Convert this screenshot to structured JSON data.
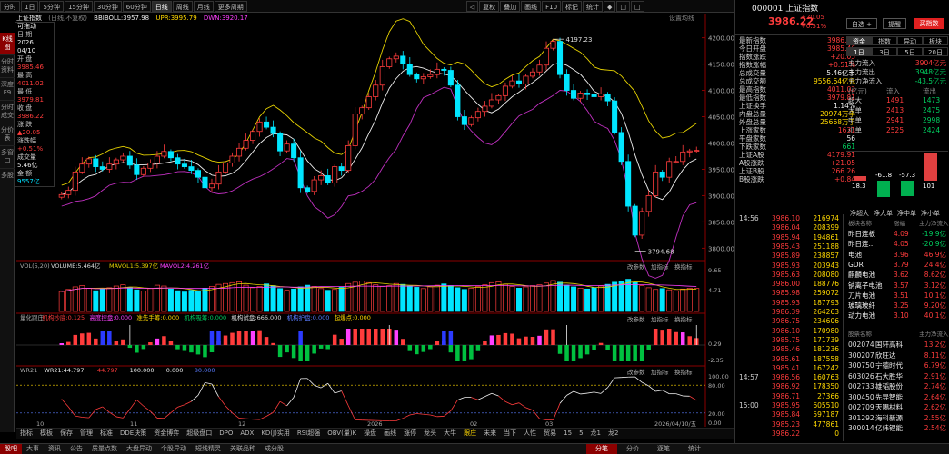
{
  "toolbar": {
    "left": [
      "分时",
      "1日",
      "5分钟",
      "15分钟",
      "30分钟",
      "60分钟",
      "日线",
      "周线",
      "月线",
      "更多周期"
    ],
    "active": "日线",
    "right": [
      "◁",
      "复权",
      "叠加",
      "画线",
      "F10",
      "标记",
      "统计",
      "◆",
      "□",
      "□"
    ]
  },
  "left_nav": [
    "K线图",
    "分时资料",
    "深度F9",
    "分时成交",
    "分价表",
    "多窗口",
    "多股"
  ],
  "left_nav_active": "K线图",
  "info_panel": {
    "title": "可拖动",
    "date_label": "日 期",
    "year": "2026",
    "date": "04/10",
    "open_label": "开 盘",
    "open": "3985.46",
    "high_label": "最 高",
    "high": "4011.02",
    "low_label": "最 低",
    "low": "3979.81",
    "close_label": "收 盘",
    "close": "3986.22",
    "change_label": "涨 跌",
    "change": "20.05",
    "pct_label": "涨跌幅",
    "pct": "+0.51%",
    "vol_label": "成交量",
    "vol": "5.46亿",
    "amt_label": "金 额",
    "amt": "9557亿"
  },
  "info_header": {
    "name": "上证指数",
    "mode": "(日线,不复权)",
    "bboll": "BBIBOLL:3957.98",
    "upr": "UPR:3995.79",
    "dwn": "DWN:3920.17",
    "settings": "设置均线"
  },
  "price_axis": [
    "4200.00",
    "4150.00",
    "4100.00",
    "4050.00",
    "4000.00",
    "3950.00",
    "3900.00",
    "3850.00",
    "3800.00"
  ],
  "chart_data": [
    {
      "type": "candlestick",
      "annotations": [
        {
          "label": "4197.23"
        },
        {
          "label": "3794.68"
        }
      ],
      "ylim": [
        3780,
        4220
      ],
      "open": [
        3897,
        3902,
        3910,
        3945,
        3960,
        3970,
        3955,
        3950,
        3960,
        3968,
        3975,
        3958,
        3940,
        3952,
        3962,
        3975,
        3984,
        3972,
        3960,
        3955,
        3948,
        3935,
        3915,
        3922,
        3945,
        3962,
        3975,
        3990,
        4005,
        4022,
        4040,
        4030,
        4018,
        3985,
        3998,
        3972,
        3915,
        3908,
        3930,
        3938,
        3924,
        3955,
        3948,
        3995,
        4055,
        4067,
        4088,
        4110,
        4145,
        4160,
        4165,
        4150,
        4130,
        4122,
        4126,
        4130,
        4140,
        4138,
        4110,
        4050,
        4035,
        4048,
        4060,
        4070,
        4082,
        4090,
        4108,
        4118,
        4112,
        4127,
        4135,
        4148,
        4180,
        4193,
        4130,
        4100,
        4085,
        4095,
        4092,
        4088,
        4093,
        4080,
        4020,
        3965,
        3880,
        3825,
        3870,
        3900,
        3945,
        3935,
        3965,
        3965,
        3983,
        3985
      ],
      "close": [
        3902,
        3910,
        3945,
        3960,
        3970,
        3955,
        3950,
        3960,
        3968,
        3975,
        3958,
        3940,
        3952,
        3962,
        3975,
        3984,
        3972,
        3960,
        3955,
        3948,
        3935,
        3915,
        3922,
        3945,
        3962,
        3975,
        3990,
        4005,
        4022,
        4040,
        4030,
        4018,
        3985,
        3998,
        3972,
        3915,
        3908,
        3930,
        3938,
        3924,
        3955,
        3948,
        3995,
        4055,
        4067,
        4088,
        4110,
        4145,
        4160,
        4165,
        4150,
        4130,
        4122,
        4126,
        4130,
        4140,
        4138,
        4110,
        4050,
        4035,
        4048,
        4060,
        4070,
        4082,
        4090,
        4108,
        4118,
        4112,
        4127,
        4135,
        4148,
        4180,
        4193,
        4130,
        4100,
        4085,
        4095,
        4092,
        4088,
        4093,
        4080,
        4020,
        3965,
        3880,
        3825,
        3870,
        3900,
        3945,
        3935,
        3965,
        3965,
        3983,
        3985,
        3986
      ]
    },
    {
      "type": "bar",
      "ylim": [
        0,
        9.65
      ],
      "values": [
        4.7,
        5.2,
        5.8,
        6.1,
        5.5,
        4.9,
        5.3,
        5.6,
        6.0,
        6.3,
        5.7,
        5.1,
        4.8,
        5.4,
        6.2,
        6.0,
        5.3,
        4.9,
        4.6,
        5.0,
        4.7,
        5.5,
        5.9,
        6.4,
        6.6,
        6.8,
        7.0,
        6.2,
        5.6,
        5.9,
        6.5,
        6.1,
        5.4,
        5.0,
        5.3,
        5.8,
        6.2,
        5.9,
        5.4,
        5.0,
        5.2,
        5.7,
        6.6,
        6.9,
        7.2,
        6.8,
        6.3,
        5.9,
        6.1,
        6.6,
        6.4,
        6.0,
        5.7,
        5.4,
        5.8,
        6.2,
        6.5,
        6.1,
        5.6,
        5.2,
        5.5,
        5.9,
        6.3,
        6.8,
        7.0,
        6.4,
        5.9,
        5.5,
        5.8,
        6.1,
        6.3,
        6.7,
        7.3,
        6.9,
        6.2,
        5.8,
        5.5,
        5.3,
        5.6,
        6.0,
        6.4,
        6.9,
        7.2,
        7.6,
        6.8,
        6.1,
        5.6,
        5.2,
        5.4,
        5.1,
        4.9,
        5.3,
        5.5,
        5.46
      ]
    }
  ],
  "vol_header": {
    "vol": "VOL(5,20)",
    "volume": "VOLUME:5.464亿",
    "mavol1": "MAVOL1:5.397亿",
    "mavol2": "MAVOL2:4.261亿"
  },
  "vol_axis": [
    "9.65",
    "4.71"
  ],
  "ind_header": {
    "name": "量化跟庄",
    "a": "机构抄底:0.125",
    "b": "高度控盘:0.000",
    "c": "准先手筹:0.000",
    "d": "机构吸筹:0.000",
    "e": "机构试盘:666.000",
    "f": "机构护盘:0.000",
    "g": "起爆点:0.000"
  },
  "ind_axis": [
    "0.29",
    "-2.35"
  ],
  "wr_header": {
    "name": "WR21",
    "w1": "WR21:44.797",
    "w2": "44.797",
    "w3": "100.000",
    "w4": "0.000",
    "w5": "80.000"
  },
  "wr_axis": [
    "100.00",
    "80.00",
    "20.00",
    "0.00"
  ],
  "pane_tools": [
    "改参数",
    "加指标",
    "换指标"
  ],
  "pane_tools_short": [
    "改参数",
    "加指标",
    "换指标"
  ],
  "x_axis": [
    "10",
    "11",
    "12",
    "2026",
    "02",
    "03",
    "2026/04/10/五"
  ],
  "chart_tabs": [
    "指标",
    "模板",
    "保存",
    "管理",
    "标准",
    "DDE决策",
    "资金博弈",
    "超级盘口",
    "DPO",
    "ADX",
    "KD(J)实用",
    "RSI超强",
    "OBV(量)K",
    "操盘",
    "画线",
    "涨停",
    "龙头",
    "大牛",
    "跟庄",
    "未来",
    "当下",
    "人性",
    "贸易",
    "15",
    "5",
    "龙1",
    "龙2"
  ],
  "chart_tabs_active": "跟庄",
  "bottom_tabs": [
    "股吧",
    "大事",
    "资讯",
    "公告",
    "质量点数",
    "大盘异动",
    "个股异动",
    "短线精灵",
    "关联品种",
    "成分股"
  ],
  "bottom_tabs_active": "股吧",
  "right_bottom_tabs": [
    "分笔",
    "分价",
    "逐笔",
    "统计"
  ],
  "quote": {
    "code": "000001",
    "name": "上证指数",
    "price": "3986.22",
    "chg": "+20.05",
    "pct": "+0.51%",
    "btn_watch": "自选 +",
    "btn_alert": "提醒",
    "btn_buy": "买指数",
    "stats": [
      [
        "最新指数",
        "3986.22",
        "red"
      ],
      [
        "今日开盘",
        "3985.46",
        "red"
      ],
      [
        "指数涨跌",
        "+20.05",
        "red"
      ],
      [
        "指数涨幅",
        "+0.51%",
        "red"
      ],
      [
        "总成交量",
        "5.46亿手",
        "white"
      ],
      [
        "总成交额",
        "9556.64亿元",
        "yellow"
      ],
      [
        "最高指数",
        "4011.02",
        "red"
      ],
      [
        "最低指数",
        "3979.81",
        "red"
      ],
      [
        "上证换手",
        "1.14%",
        "white"
      ],
      [
        "内盘总量",
        "20974万手",
        "yellow"
      ],
      [
        "外盘总量",
        "25668万手",
        "yellow"
      ],
      [
        "上涨家数",
        "1631",
        "red"
      ],
      [
        "平盘家数",
        "56",
        "white"
      ],
      [
        "下跌家数",
        "661",
        "green"
      ],
      [
        "上证A股",
        "4179.91",
        "red"
      ],
      [
        "A股涨跌",
        "+21.05",
        "red"
      ],
      [
        "上证B股",
        "266.26",
        "red"
      ],
      [
        "B股涨跌",
        "+0.84",
        "red"
      ]
    ],
    "fund_tabs": [
      "资金",
      "指数",
      "异动",
      "板块"
    ],
    "period_tabs": [
      "1日",
      "3日",
      "5日",
      "20日"
    ],
    "flows": [
      [
        "主力流入",
        "3904亿元",
        "red"
      ],
      [
        "主力流出",
        "3948亿元",
        "green"
      ],
      [
        "主力净流入",
        "-43.5亿元",
        "green"
      ]
    ],
    "flow_header": [
      "(亿元)",
      "流入",
      "流出"
    ],
    "flow_rows": [
      [
        "超大",
        "1491",
        "1473"
      ],
      [
        "大单",
        "2413",
        "2475"
      ],
      [
        "中单",
        "2941",
        "2998"
      ],
      [
        "小单",
        "2525",
        "2424"
      ]
    ],
    "net_values": [
      "18.3",
      "-61.8",
      "-57.3",
      "101"
    ],
    "net_labels": [
      "净超大",
      "净大单",
      "净中单",
      "净小单"
    ],
    "ticks": [
      [
        "14:56",
        "3986.10",
        "216974"
      ],
      [
        "",
        "3986.04",
        "208399"
      ],
      [
        "",
        "3985.94",
        "194861"
      ],
      [
        "",
        "3985.43",
        "251188"
      ],
      [
        "",
        "3985.89",
        "238857"
      ],
      [
        "",
        "3985.93",
        "203943"
      ],
      [
        "",
        "3985.63",
        "208080"
      ],
      [
        "",
        "3986.00",
        "188776"
      ],
      [
        "",
        "3985.98",
        "259072"
      ],
      [
        "",
        "3985.93",
        "187793"
      ],
      [
        "",
        "3986.39",
        "264263"
      ],
      [
        "",
        "3986.75",
        "234606"
      ],
      [
        "",
        "3986.10",
        "170980"
      ],
      [
        "",
        "3985.75",
        "171739"
      ],
      [
        "",
        "3985.46",
        "181236"
      ],
      [
        "",
        "3985.61",
        "187558"
      ],
      [
        "",
        "3985.41",
        "167242"
      ],
      [
        "14:57",
        "3986.56",
        "160763"
      ],
      [
        "",
        "3986.92",
        "178350"
      ],
      [
        "",
        "3986.71",
        "27366"
      ],
      [
        "15:00",
        "3985.95",
        "605510"
      ],
      [
        "",
        "3985.84",
        "597187"
      ],
      [
        "",
        "3985.23",
        "477861"
      ],
      [
        "",
        "3986.22",
        "0"
      ]
    ],
    "sector_header": [
      "板块名称",
      "涨幅",
      "主力净流入"
    ],
    "sectors": [
      [
        "昨日连板",
        "4.09",
        "-19.9亿"
      ],
      [
        "昨日连...",
        "4.05",
        "-20.9亿"
      ],
      [
        "电池",
        "3.96",
        "46.9亿"
      ],
      [
        "GDR",
        "3.79",
        "24.4亿"
      ],
      [
        "麒麟电池",
        "3.62",
        "8.62亿"
      ],
      [
        "钠离子电池",
        "3.57",
        "3.12亿"
      ],
      [
        "刀片电池",
        "3.51",
        "10.1亿"
      ],
      [
        "玻璃玻纤",
        "3.25",
        "9.20亿"
      ],
      [
        "动力电池",
        "3.10",
        "40.1亿"
      ]
    ],
    "stock_header": [
      "股票名称",
      "主力净流入"
    ],
    "stocks": [
      [
        "002074",
        "国轩高科",
        "13.2亿"
      ],
      [
        "300207",
        "欣旺达",
        "8.11亿"
      ],
      [
        "300750",
        "宁德时代",
        "6.79亿"
      ],
      [
        "603026",
        "石大胜华",
        "2.91亿"
      ],
      [
        "002733",
        "雄韬股份",
        "2.74亿"
      ],
      [
        "300450",
        "先导智能",
        "2.64亿"
      ],
      [
        "002709",
        "天赐材料",
        "2.62亿"
      ],
      [
        "301292",
        "海科新源",
        "2.55亿"
      ],
      [
        "300014",
        "亿纬锂能",
        "2.54亿"
      ]
    ]
  }
}
